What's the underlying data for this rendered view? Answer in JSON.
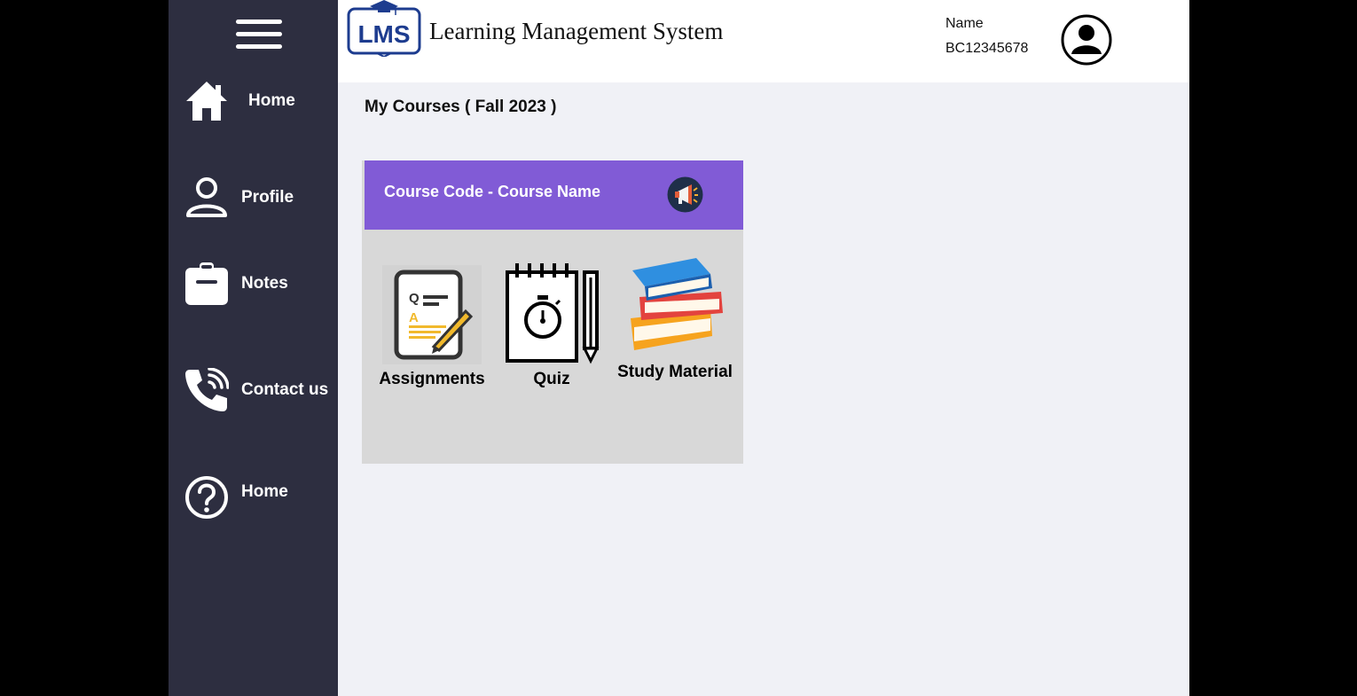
{
  "app": {
    "logo_text": "LMS",
    "title": "Learning Management System"
  },
  "user": {
    "name": "Name",
    "id": "BC12345678"
  },
  "sidebar": {
    "items": [
      {
        "label": "Home",
        "icon": "home-icon"
      },
      {
        "label": "Profile",
        "icon": "user-icon"
      },
      {
        "label": "Notes",
        "icon": "clipboard-icon"
      },
      {
        "label": "Contact us",
        "icon": "phone-icon"
      },
      {
        "label": "Home",
        "icon": "help-icon"
      }
    ]
  },
  "main": {
    "heading": "My Courses ( Fall 2023 )",
    "course": {
      "title": "Course Code - Course Name",
      "announce_icon": "megaphone-icon",
      "tiles": [
        {
          "label": "Assignments",
          "icon": "assignment-icon"
        },
        {
          "label": "Quiz",
          "icon": "quiz-icon"
        },
        {
          "label": "Study Material",
          "icon": "books-icon"
        }
      ]
    }
  },
  "colors": {
    "sidebar_bg": "#2d2e40",
    "content_bg": "#f0f1f6",
    "course_header": "#815bd6",
    "card_bg": "#d8d8d8",
    "logo_blue": "#1d3c8f"
  }
}
